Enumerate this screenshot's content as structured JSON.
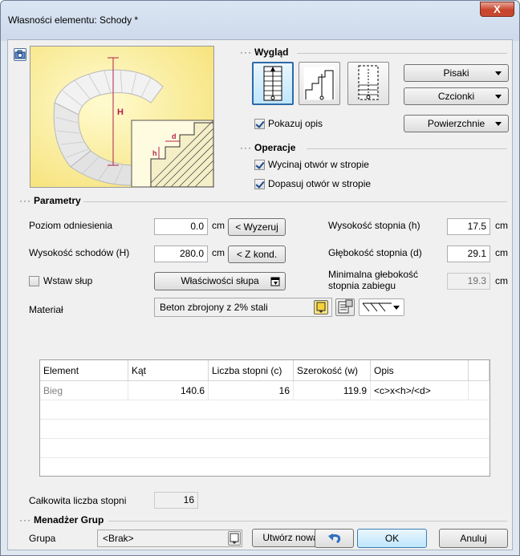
{
  "window": {
    "title": "Własności elementu: Schody *",
    "close_label": "X"
  },
  "appearance": {
    "heading": "Wygląd",
    "show_description_label": "Pokazuj opis",
    "show_description_checked": true,
    "pens_label": "Pisaki",
    "fonts_label": "Czcionki",
    "surfaces_label": "Powierzchnie",
    "view_icons": [
      "stair-plan-view-icon",
      "stair-section-view-icon",
      "stair-plan-dashed-view-icon"
    ]
  },
  "operations": {
    "heading": "Operacje",
    "cut_opening_label": "Wycinaj otwór w stropie",
    "cut_opening_checked": true,
    "fit_opening_label": "Dopasuj otwór w stropie",
    "fit_opening_checked": true
  },
  "preview": {
    "h_label": "H",
    "small_h": "h",
    "small_d": "d"
  },
  "parameters": {
    "heading": "Parametry",
    "reference_level_label": "Poziom odniesienia",
    "reference_level_value": "0.0",
    "reference_level_unit": "cm",
    "reset_button": "< Wyzeruj",
    "stair_height_label": "Wysokość schodów (H)",
    "stair_height_value": "280.0",
    "stair_height_unit": "cm",
    "from_story_button": "< Z kond.",
    "step_height_label": "Wysokość stopnia (h)",
    "step_height_value": "17.5",
    "step_height_unit": "cm",
    "step_depth_label": "Głębokość stopnia (d)",
    "step_depth_value": "29.1",
    "step_depth_unit": "cm",
    "min_depth_label_1": "Minimalna głebokość",
    "min_depth_label_2": "stopnia zabiegu",
    "min_depth_value": "19.3",
    "min_depth_unit": "cm",
    "insert_column_label": "Wstaw słup",
    "insert_column_checked": false,
    "column_props_button": "Właściwości słupa",
    "material_label": "Materiał",
    "material_value": "Beton zbrojony z 2% stali"
  },
  "table": {
    "columns": [
      "Element",
      "Kąt",
      "Liczba stopni (c)",
      "Szerokość (w)",
      "Opis"
    ],
    "rows": [
      {
        "element": "Bieg",
        "angle": "140.6",
        "steps": "16",
        "width": "119.9",
        "desc": "<c>x<h>/<d>"
      }
    ]
  },
  "total_steps": {
    "label": "Całkowita liczba stopni",
    "value": "16"
  },
  "group_manager": {
    "heading": "Menadżer Grup",
    "group_label": "Grupa",
    "group_value": "<Brak>",
    "create_button": "Utwórz nową"
  },
  "footer": {
    "ok_label": "OK",
    "cancel_label": "Anuluj"
  }
}
